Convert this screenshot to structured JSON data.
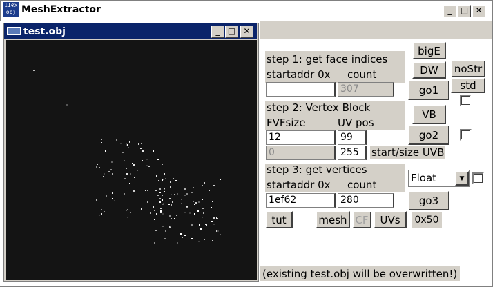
{
  "app": {
    "title": "MeshExtractor",
    "icon_lines": [
      "II⊗x",
      "obj"
    ],
    "controls": [
      "_",
      "□",
      "✕"
    ]
  },
  "child_window": {
    "title": "test.obj",
    "controls": [
      "_",
      "□",
      "✕"
    ]
  },
  "step1": {
    "heading": "step 1: get face indices",
    "startaddr_label": "startaddr 0x",
    "count_label": "count",
    "startaddr_value": "",
    "count_value": "307"
  },
  "step2": {
    "heading": "step 2: Vertex Block",
    "fvf_label": "FVFsize",
    "uvpos_label": "UV pos",
    "fvf_value": "12",
    "uvpos_value": "99",
    "start_uvb_value": "0",
    "size_uvb_value": "255",
    "uvb_label": "start/size UVB"
  },
  "step3": {
    "heading": "step 3: get vertices",
    "startaddr_label": "startaddr 0x",
    "count_label": "count",
    "startaddr_value": "1ef62",
    "count_value": "280",
    "format_selected": "Float"
  },
  "buttons": {
    "bigE": "bigE",
    "dw": "DW",
    "nostr": "noStr",
    "std": "std",
    "go1": "go1",
    "vb": "VB",
    "go2": "go2",
    "go3": "go3",
    "tut": "tut",
    "mesh": "mesh",
    "cf": "CF",
    "uvs": "UVs"
  },
  "hex_readout": "0x50",
  "status": "(existing test.obj will be overwritten!)",
  "colors": {
    "child_titlebar": "#0a246a",
    "dialog_gray": "#d4d0c8",
    "viewport_bg": "#141414"
  }
}
